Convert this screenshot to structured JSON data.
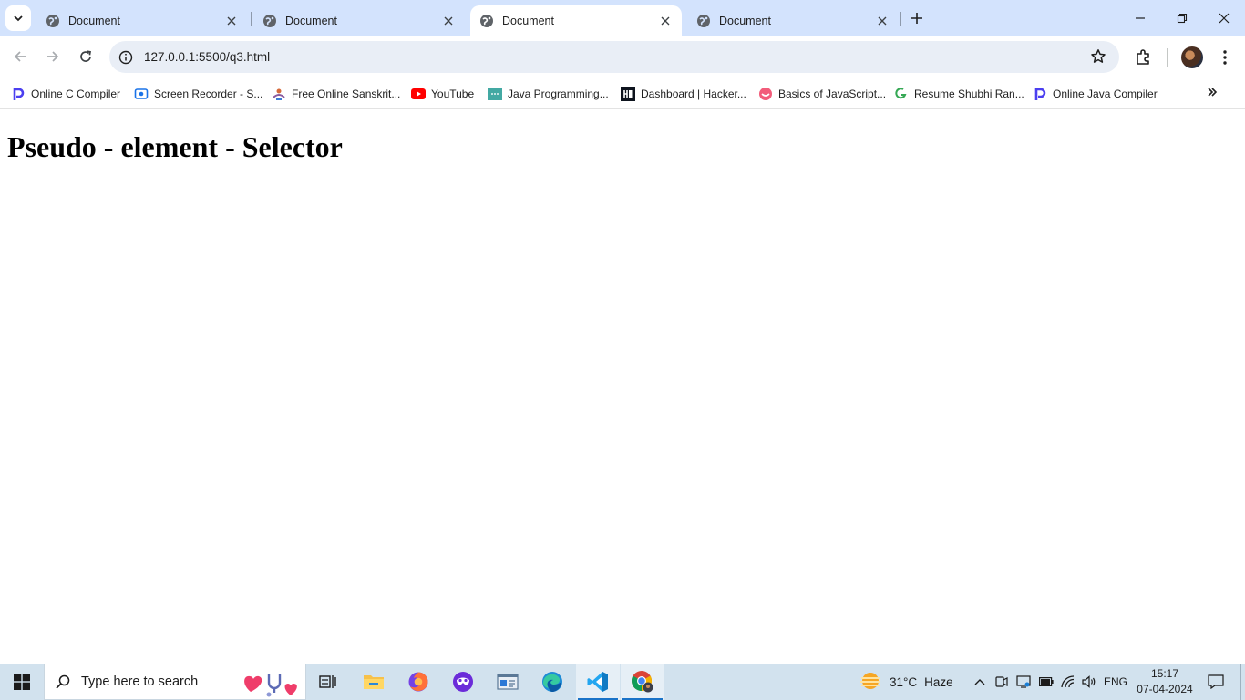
{
  "tabs": [
    {
      "title": "Document",
      "active": false
    },
    {
      "title": "Document",
      "active": false
    },
    {
      "title": "Document",
      "active": true
    },
    {
      "title": "Document",
      "active": false
    }
  ],
  "address_bar": {
    "url": "127.0.0.1:5500/q3.html"
  },
  "bookmarks": [
    {
      "label": "Online C Compiler",
      "icon": "programiz-icon"
    },
    {
      "label": "Screen Recorder - S...",
      "icon": "screen-recorder-icon"
    },
    {
      "label": "Free Online Sanskrit...",
      "icon": "sanskrit-icon"
    },
    {
      "label": "YouTube",
      "icon": "youtube-icon"
    },
    {
      "label": "Java Programming...",
      "icon": "java-icon"
    },
    {
      "label": "Dashboard | Hacker...",
      "icon": "hackerrank-icon"
    },
    {
      "label": "Basics of JavaScript...",
      "icon": "javascript-icon"
    },
    {
      "label": "Resume Shubhi Ran...",
      "icon": "resume-icon"
    },
    {
      "label": "Online Java Compiler",
      "icon": "programiz-icon"
    }
  ],
  "page": {
    "heading": "Pseudo - element - Selector"
  },
  "taskbar": {
    "search_placeholder": "Type here to search",
    "apps": [
      "task-view",
      "file-explorer",
      "firefox",
      "app-mask",
      "app-window",
      "edge",
      "vscode",
      "chrome"
    ],
    "active_app": "chrome",
    "weather": {
      "temp": "31°C",
      "condition": "Haze"
    },
    "language": "ENG",
    "time": "15:17",
    "date": "07-04-2024"
  },
  "colors": {
    "tabstrip": "#d3e3fd",
    "omnibox": "#e9eef6",
    "taskbar": "#d2e2ee"
  }
}
